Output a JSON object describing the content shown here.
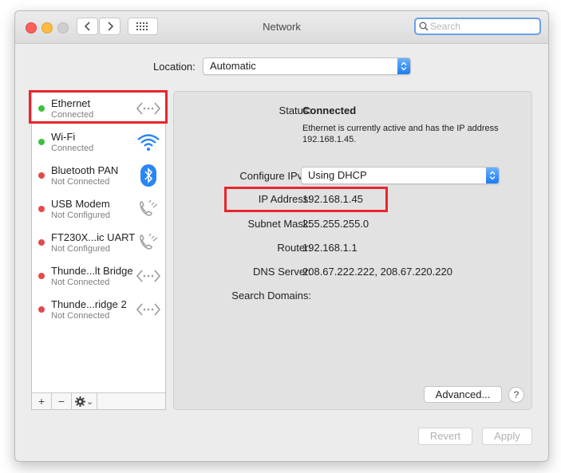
{
  "window": {
    "title": "Network",
    "search_placeholder": "Search"
  },
  "location": {
    "label": "Location:",
    "value": "Automatic"
  },
  "services": [
    {
      "name": "Ethernet",
      "status": "Connected",
      "status_color": "#3fbf3f",
      "icon": "ethernet-icon"
    },
    {
      "name": "Wi-Fi",
      "status": "Connected",
      "status_color": "#3fbf3f",
      "icon": "wifi-icon"
    },
    {
      "name": "Bluetooth PAN",
      "status": "Not Connected",
      "status_color": "#e34a4a",
      "icon": "bluetooth-icon"
    },
    {
      "name": "USB Modem",
      "status": "Not Configured",
      "status_color": "#e34a4a",
      "icon": "phone-icon"
    },
    {
      "name": "FT230X...ic UART",
      "status": "Not Configured",
      "status_color": "#e34a4a",
      "icon": "phone-icon"
    },
    {
      "name": "Thunde...lt Bridge",
      "status": "Not Connected",
      "status_color": "#e34a4a",
      "icon": "ethernet-icon"
    },
    {
      "name": "Thunde...ridge 2",
      "status": "Not Connected",
      "status_color": "#e34a4a",
      "icon": "ethernet-icon"
    }
  ],
  "sidebar_footer": {
    "add": "+",
    "remove": "−",
    "gear_caret": "⌄"
  },
  "details": {
    "status_label": "Status:",
    "status_value": "Connected",
    "status_desc": "Ethernet is currently active and has the IP address 192.168.1.45.",
    "configure_label": "Configure IPv4:",
    "configure_value": "Using DHCP",
    "ip_label": "IP Address:",
    "ip_value": "192.168.1.45",
    "subnet_label": "Subnet Mask:",
    "subnet_value": "255.255.255.0",
    "router_label": "Router:",
    "router_value": "192.168.1.1",
    "dns_label": "DNS Server:",
    "dns_value": "208.67.222.222, 208.67.220.220",
    "search_domains_label": "Search Domains:",
    "search_domains_value": ""
  },
  "buttons": {
    "advanced": "Advanced...",
    "help": "?",
    "revert": "Revert",
    "apply": "Apply"
  },
  "colors": {
    "accent": "#1a7cf4",
    "highlight": "#e8262c",
    "connected": "#3fbf3f",
    "disconnected": "#e34a4a"
  }
}
